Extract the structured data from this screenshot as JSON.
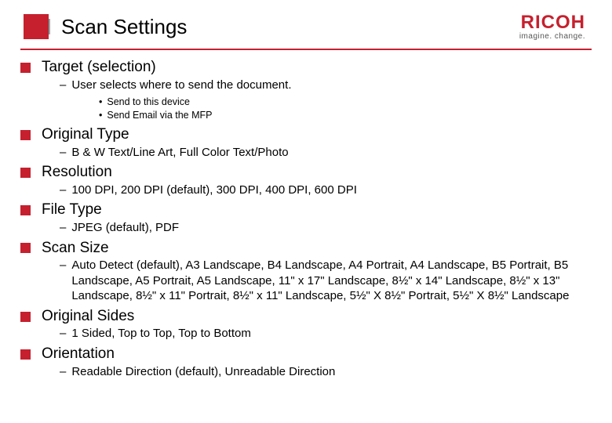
{
  "logo": {
    "brand": "RICOH",
    "tagline": "imagine. change."
  },
  "title": "Scan Settings",
  "sections": [
    {
      "heading": "Target (selection)",
      "sub": "User selects where to send the document.",
      "bullets": [
        "Send to this device",
        "Send Email via the MFP"
      ]
    },
    {
      "heading": "Original Type",
      "sub": "B & W Text/Line Art, Full Color Text/Photo"
    },
    {
      "heading": "Resolution",
      "sub": "100 DPI, 200 DPI (default), 300 DPI, 400 DPI, 600 DPI"
    },
    {
      "heading": "File Type",
      "sub": "JPEG (default), PDF"
    },
    {
      "heading": "Scan Size",
      "sub": "Auto Detect (default), A3 Landscape, B4 Landscape, A4 Portrait, A4 Landscape, B5 Portrait, B5 Landscape, A5 Portrait, A5 Landscape, 11\" x 17\" Landscape, 8½\" x 14\" Landscape, 8½\" x 13\" Landscape, 8½\" x 11\" Portrait, 8½\" x 11\" Landscape, 5½\" X 8½\" Portrait, 5½\" X 8½\" Landscape"
    },
    {
      "heading": "Original Sides",
      "sub": "1 Sided, Top to Top, Top to Bottom"
    },
    {
      "heading": "Orientation",
      "sub": "Readable Direction (default), Unreadable Direction"
    }
  ]
}
